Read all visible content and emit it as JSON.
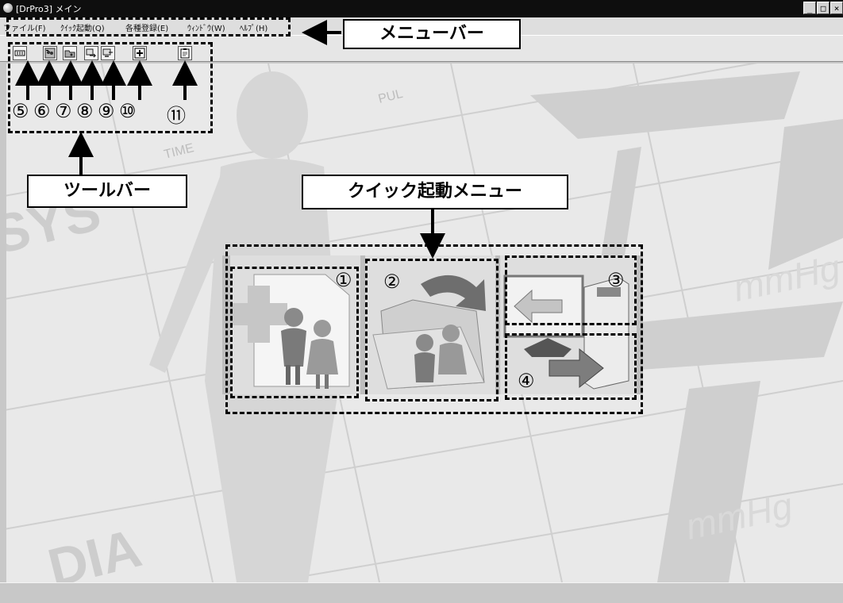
{
  "window": {
    "title": "[DrPro3] メイン",
    "controls": {
      "minimize": "_",
      "maximize": "□",
      "close": "×"
    }
  },
  "menu": {
    "items": [
      {
        "label": "ファイル(F)"
      },
      {
        "label": "ｸｲｯｸ起動(Q)"
      },
      {
        "label": "各種登録(E)"
      },
      {
        "label": "ｳｨﾝﾄﾞｳ(W)"
      },
      {
        "label": "ﾍﾙﾌﾟ(H)"
      }
    ]
  },
  "toolbar": {
    "buttons": [
      {
        "icon": "keyboard-icon"
      },
      {
        "icon": "patient-register-icon"
      },
      {
        "icon": "open-folder-icon"
      },
      {
        "icon": "data-transfer-icon"
      },
      {
        "icon": "export-icon"
      },
      {
        "icon": "add-icon"
      },
      {
        "icon": "clipboard-icon"
      }
    ]
  },
  "workspace": {
    "background_words": {
      "sys": "SYS",
      "dia": "DIA",
      "mmhg": "mmHg",
      "time": "TIME",
      "pul": "PUL"
    }
  },
  "quick_menu": {
    "tiles": [
      {
        "icon": "new-patient-icon"
      },
      {
        "icon": "open-patient-folder-icon"
      },
      {
        "icon": "pc-to-device-icon"
      }
    ]
  },
  "annotations": {
    "menubar_label": "メニューバー",
    "toolbar_label": "ツールバー",
    "quick_menu_label": "クイック起動メニュー",
    "numbers": {
      "n1": "①",
      "n2": "②",
      "n3": "③",
      "n4": "④",
      "n5": "⑤",
      "n6": "⑥",
      "n7": "⑦",
      "n8": "⑧",
      "n9": "⑨",
      "n10": "⑩",
      "n11": "⑪"
    }
  },
  "colors": {
    "titlebar": "#0e0e0e",
    "menubar": "#dedede",
    "workspace": "#e9e9e9"
  }
}
